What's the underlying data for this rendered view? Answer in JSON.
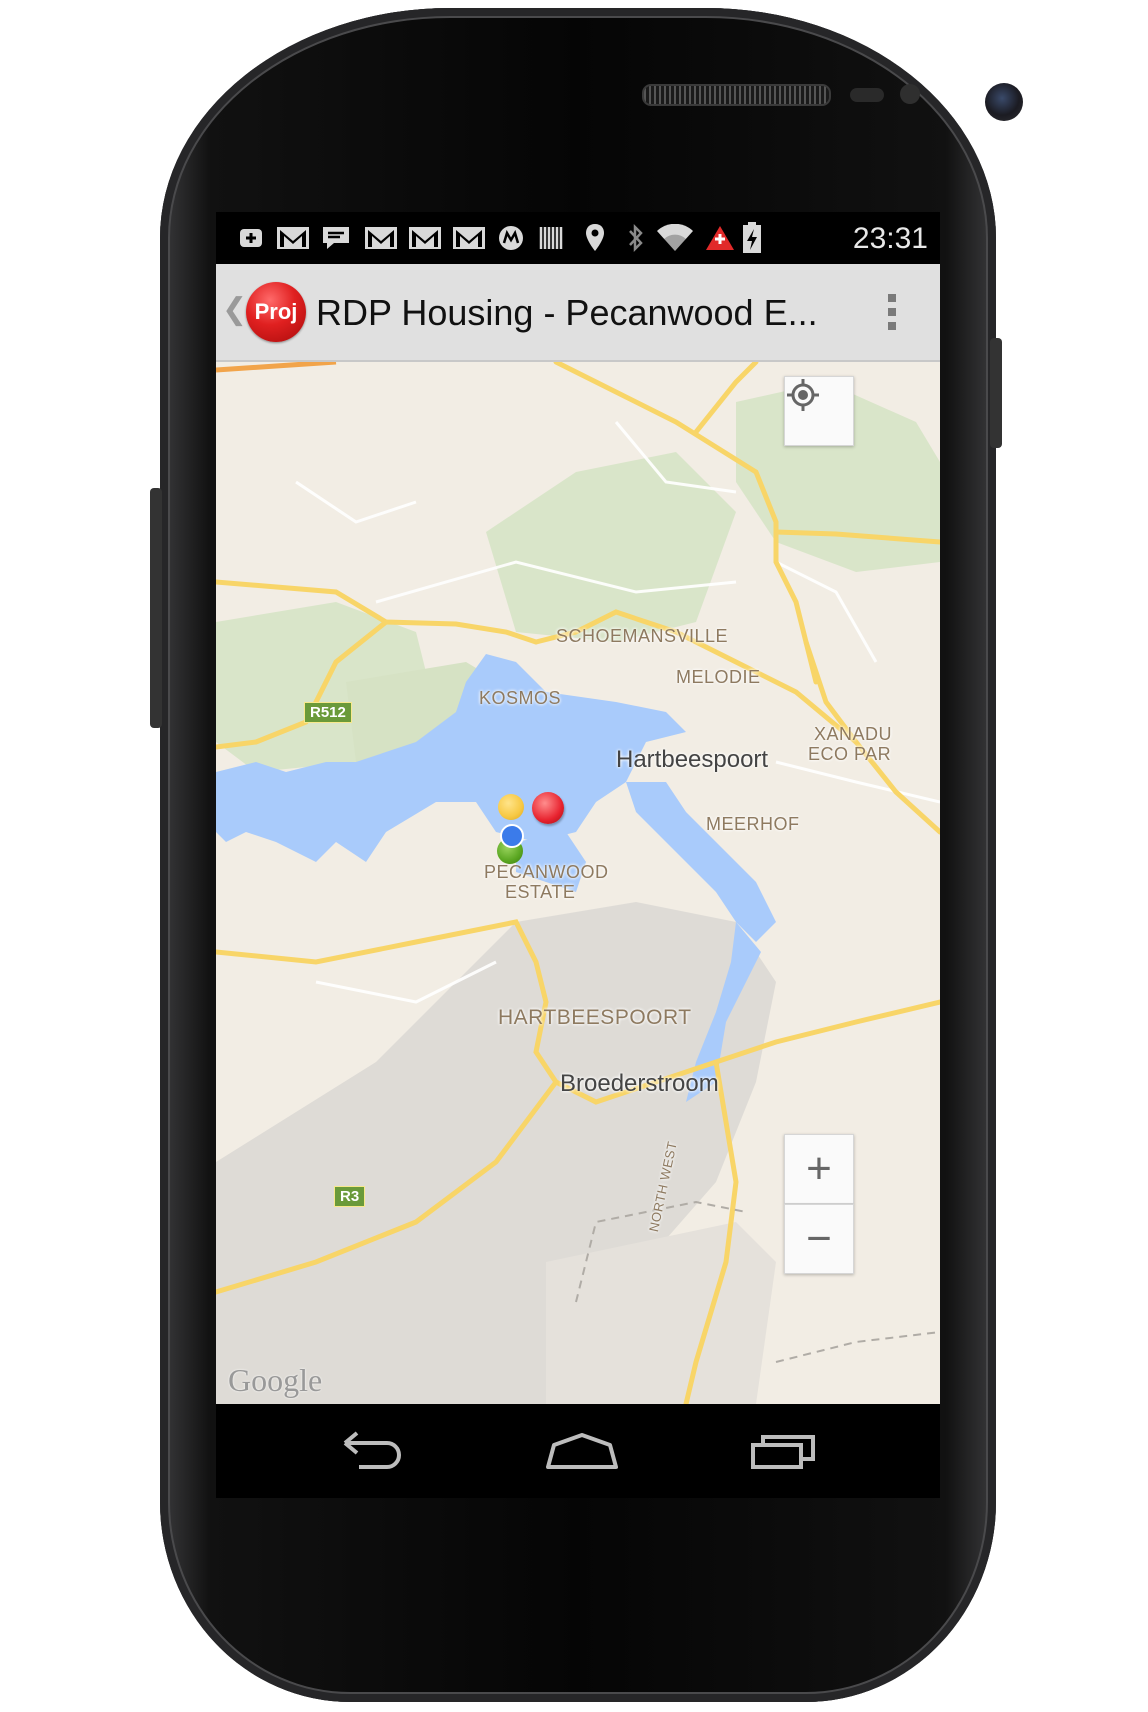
{
  "status_bar": {
    "time": "23:31",
    "icons": [
      "add-notification-icon",
      "gmail-icon",
      "chat-bubble-icon",
      "gmail-icon",
      "gmail-icon",
      "gmail-icon",
      "motorola-icon",
      "barcode-icon",
      "location-pin-icon",
      "bluetooth-icon",
      "wifi-icon",
      "alert-triangle-icon",
      "battery-charging-icon"
    ]
  },
  "action_bar": {
    "back_glyph": "❮",
    "logo_text": "Proj",
    "title": "RDP Housing - Pecanwood E..."
  },
  "map": {
    "labels": {
      "schoemansville": "SCHOEMANSVILLE",
      "melodie": "MELODIE",
      "kosmos": "KOSMOS",
      "hartbeespoort_city": "Hartbeespoort",
      "xanadu_1": "XANADU",
      "xanadu_2": "ECO PAR",
      "meerhof": "MEERHOF",
      "pecanwood_1": "PECANWOOD",
      "pecanwood_2": "ESTATE",
      "hartbeespoort_area": "HARTBEESPOORT",
      "broederstroom": "Broederstroom",
      "north_west": "NORTH WEST"
    },
    "road_shields": {
      "r512": "R512",
      "r3": "R3"
    },
    "attribution": "Google",
    "zoom_in": "+",
    "zoom_out": "−",
    "markers": [
      {
        "name": "yellow-marker",
        "color": "#f7c843"
      },
      {
        "name": "red-marker",
        "color": "#e8232f"
      },
      {
        "name": "blue-marker",
        "color": "#3b7bea"
      },
      {
        "name": "green-marker",
        "color": "#5aa621"
      }
    ],
    "colors": {
      "water": "#a9cbfb",
      "land": "#f2ede4",
      "park": "#d9e5c9",
      "highway": "#f8d568",
      "mountain": "#dedbd6"
    }
  }
}
